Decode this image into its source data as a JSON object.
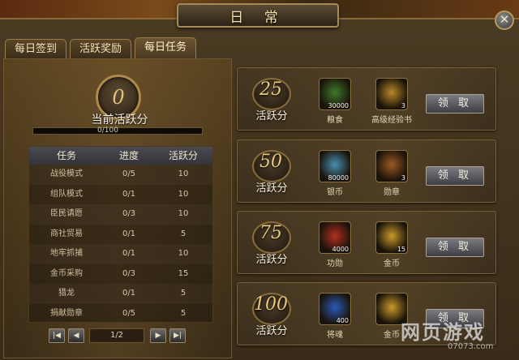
{
  "window": {
    "title": "日  常",
    "close_glyph": "✕"
  },
  "tabs": [
    {
      "label": "每日签到"
    },
    {
      "label": "活跃奖励"
    },
    {
      "label": "每日任务",
      "active": true
    }
  ],
  "activity": {
    "score": "0",
    "label": "当前活跃分",
    "progress_text": "0/100",
    "progress_fraction": 0
  },
  "task_table": {
    "headers": [
      "任务",
      "进度",
      "活跃分"
    ],
    "rows": [
      [
        "战役模式",
        "0/5",
        "10"
      ],
      [
        "组队模式",
        "0/1",
        "10"
      ],
      [
        "臣民请愿",
        "0/3",
        "10"
      ],
      [
        "商社贸易",
        "0/1",
        "5"
      ],
      [
        "地牢抓捕",
        "0/1",
        "10"
      ],
      [
        "金币采购",
        "0/3",
        "15"
      ],
      [
        "猎龙",
        "0/1",
        "5"
      ],
      [
        "捐献勋章",
        "0/5",
        "5"
      ]
    ]
  },
  "pager": {
    "page": "1/2"
  },
  "rewards": [
    {
      "tier": "25",
      "label": "活跃分",
      "button": "领 取",
      "items": [
        {
          "name": "粮食",
          "qty": "30000",
          "icon": "grain-icon",
          "color": "#3f7a2a"
        },
        {
          "name": "高级经验书",
          "qty": "3",
          "icon": "exp-book-icon",
          "color": "#b8862a"
        }
      ]
    },
    {
      "tier": "50",
      "label": "活跃分",
      "button": "领 取",
      "items": [
        {
          "name": "银币",
          "qty": "80000",
          "icon": "silver-coin-icon",
          "color": "#4a8fb0"
        },
        {
          "name": "勋章",
          "qty": "3",
          "icon": "medal-icon",
          "color": "#9a5a22"
        }
      ]
    },
    {
      "tier": "75",
      "label": "活跃分",
      "button": "领 取",
      "items": [
        {
          "name": "功勋",
          "qty": "4000",
          "icon": "merit-icon",
          "color": "#b03020"
        },
        {
          "name": "金币",
          "qty": "15",
          "icon": "gold-coin-icon",
          "color": "#c89a2a"
        }
      ]
    },
    {
      "tier": "100",
      "label": "活跃分",
      "button": "领 取",
      "items": [
        {
          "name": "将魂",
          "qty": "400",
          "icon": "soul-icon",
          "color": "#2a5ab8"
        },
        {
          "name": "金币",
          "qty": "",
          "icon": "gold-coin-icon",
          "color": "#c89a2a"
        }
      ]
    }
  ],
  "watermark": {
    "text": "网页游戏",
    "url": "07073.com"
  }
}
